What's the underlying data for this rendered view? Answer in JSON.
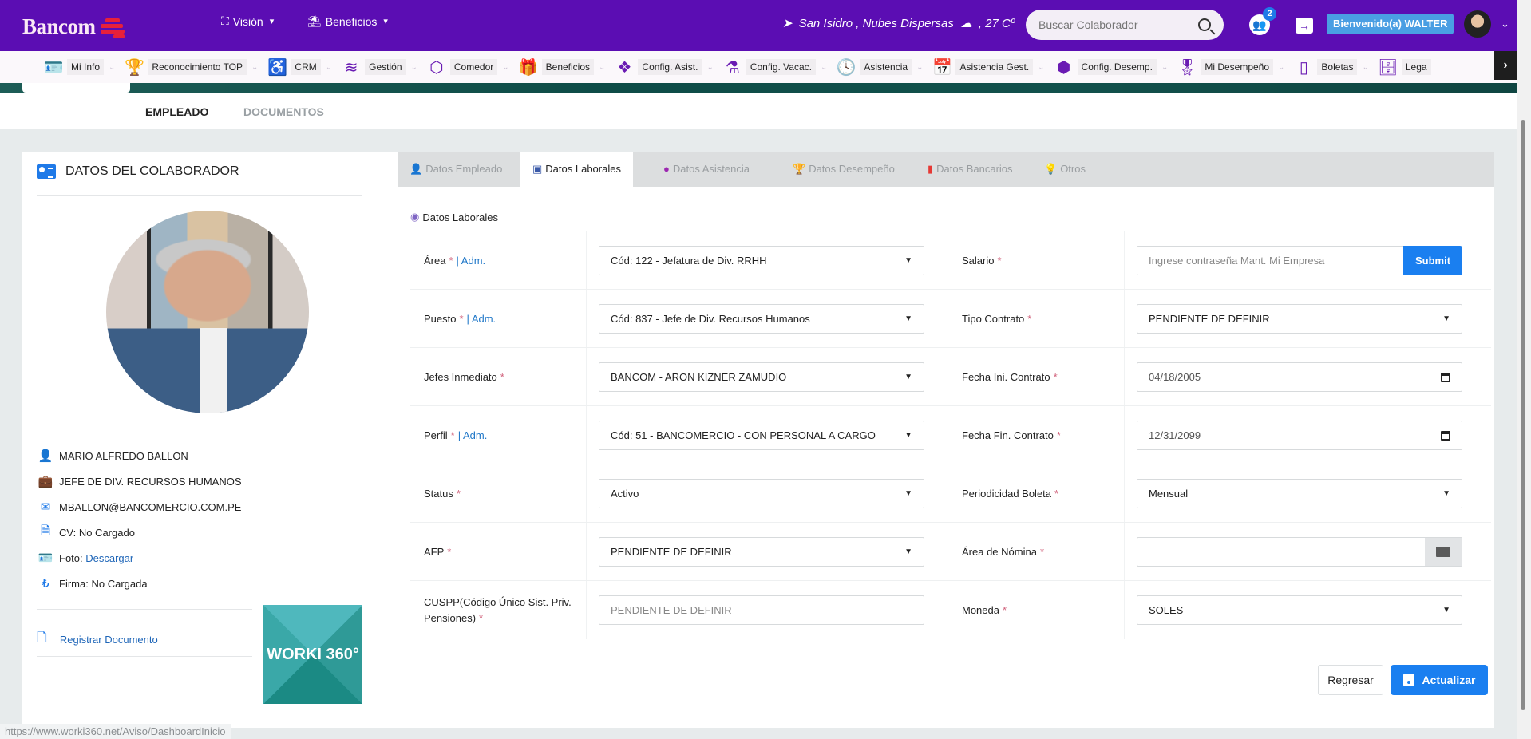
{
  "header": {
    "brand": "Bancom",
    "menus": [
      {
        "label": "Visión",
        "icon": "expand-icon"
      },
      {
        "label": "Beneficios",
        "icon": "beach-umbrella-icon"
      }
    ],
    "weather": {
      "location": "San Isidro , Nubes Dispersas",
      "temp": ", 27 Cº"
    },
    "search_placeholder": "Buscar Colaborador",
    "notification_count": "2",
    "welcome": "Bienvenido(a) WALTER"
  },
  "navbar": {
    "items": [
      {
        "label": "Mi Info",
        "icon": "id-card-icon"
      },
      {
        "label": "Reconocimiento TOP",
        "icon": "trophy-icon"
      },
      {
        "label": "CRM",
        "icon": "accessibility-icon"
      },
      {
        "label": "Gestión",
        "icon": "stack-icon"
      },
      {
        "label": "Comedor",
        "icon": "hexagon-icon"
      },
      {
        "label": "Beneficios",
        "icon": "gift-icon"
      },
      {
        "label": "Config. Asist.",
        "icon": "dropbox-icon"
      },
      {
        "label": "Config. Vacac.",
        "icon": "flask-icon"
      },
      {
        "label": "Asistencia",
        "icon": "clock-icon"
      },
      {
        "label": "Asistencia Gest.",
        "icon": "calendar-icon"
      },
      {
        "label": "Config. Desemp.",
        "icon": "cube-icon"
      },
      {
        "label": "Mi Desempeño",
        "icon": "award-icon"
      },
      {
        "label": "Boletas",
        "icon": "document-icon"
      },
      {
        "label": "Lega",
        "icon": "archive-icon"
      }
    ]
  },
  "section_tabs": {
    "active": "EMPLEADO",
    "inactive": "DOCUMENTOS"
  },
  "collaborator": {
    "title": "DATOS DEL COLABORADOR",
    "name": "MARIO ALFREDO BALLON",
    "position": "JEFE DE DIV. RECURSOS HUMANOS",
    "email": "MBALLON@BANCOMERCIO.COM.PE",
    "cv_label": "CV:",
    "cv_value": "No Cargado",
    "photo_label": "Foto:",
    "photo_link": "Descargar",
    "signature_label": "Firma:",
    "signature_value": "No Cargada",
    "register_doc": "Registrar Documento",
    "worki_badge": "WORKI 360°"
  },
  "tabs": [
    {
      "label": "Datos Empleado",
      "color": "#1f7ae8",
      "active": false
    },
    {
      "label": "Datos Laborales",
      "color": "#3b5aa8",
      "active": true
    },
    {
      "label": "Datos Asistencia",
      "color": "#9c27b0",
      "active": false
    },
    {
      "label": "Datos Desempeño",
      "color": "#4caf50",
      "active": false
    },
    {
      "label": "Datos Bancarios",
      "color": "#e53935",
      "active": false
    },
    {
      "label": "Otros",
      "color": "#f5a623",
      "active": false
    }
  ],
  "subheading": "Datos Laborales",
  "form": {
    "left": [
      {
        "label": "Área",
        "required": "*",
        "admin": "| Adm.",
        "value": "Cód: 122 - Jefatura de Div. RRHH",
        "type": "select"
      },
      {
        "label": "Puesto",
        "required": "*",
        "admin": "| Adm.",
        "value": "Cód: 837 - Jefe de Div. Recursos Humanos",
        "type": "select"
      },
      {
        "label": "Jefes Inmediato",
        "required": "*",
        "admin": "",
        "value": "BANCOM - ARON KIZNER ZAMUDIO",
        "type": "select"
      },
      {
        "label": "Perfil",
        "required": "*",
        "admin": "| Adm.",
        "value": "Cód: 51 - BANCOMERCIO - CON PERSONAL A CARGO",
        "type": "select"
      },
      {
        "label": "Status",
        "required": "*",
        "admin": "",
        "value": "Activo",
        "type": "select"
      },
      {
        "label": "AFP",
        "required": "*",
        "admin": "",
        "value": "PENDIENTE DE DEFINIR",
        "type": "select"
      },
      {
        "label": "CUSPP(Código Único Sist. Priv. Pensiones)",
        "required": "*",
        "admin": "",
        "placeholder": "PENDIENTE DE DEFINIR",
        "type": "text"
      }
    ],
    "right": [
      {
        "label": "Salario",
        "required": "*",
        "placeholder": "Ingrese contraseña Mant. Mi Empresa",
        "button": "Submit",
        "type": "password"
      },
      {
        "label": "Tipo Contrato",
        "required": "*",
        "value": "PENDIENTE DE DEFINIR",
        "type": "select"
      },
      {
        "label": "Fecha Ini. Contrato",
        "required": "*",
        "value": "04/18/2005",
        "type": "date"
      },
      {
        "label": "Fecha Fin. Contrato",
        "required": "*",
        "value": "12/31/2099",
        "type": "date"
      },
      {
        "label": "Periodicidad Boleta",
        "required": "*",
        "value": "Mensual",
        "type": "select"
      },
      {
        "label": "Área de Nómina",
        "required": "*",
        "value": "",
        "type": "addon"
      },
      {
        "label": "Moneda",
        "required": "*",
        "value": "SOLES",
        "type": "select"
      }
    ]
  },
  "actions": {
    "back": "Regresar",
    "update": "Actualizar"
  },
  "status_url": "https://www.worki360.net/Aviso/DashboardInicio"
}
